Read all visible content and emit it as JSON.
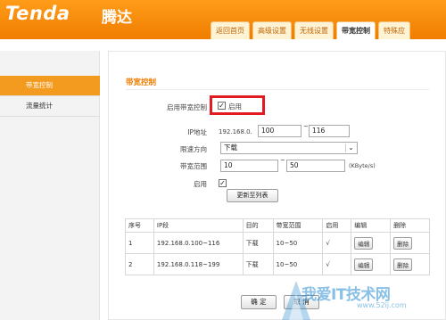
{
  "header": {
    "logo": "Tenda",
    "logo_cn": "腾达",
    "tabs": [
      {
        "label": "返回首页"
      },
      {
        "label": "高级设置"
      },
      {
        "label": "无线设置"
      },
      {
        "label": "带宽控制",
        "active": true
      },
      {
        "label": "特殊应"
      }
    ]
  },
  "sidebar": {
    "items": [
      {
        "label": "带宽控制",
        "active": true
      },
      {
        "label": "流量统计"
      }
    ]
  },
  "form": {
    "title": "带宽控制",
    "enable_label": "启用带宽控制",
    "enable_checkbox_text": "启用",
    "enable_checked": true,
    "ip_label": "IP地址",
    "ip_prefix": "192.168.0.",
    "ip_start": "100",
    "ip_tilde": "~",
    "ip_end": "116",
    "direction_label": "限速方向",
    "direction_value": "下载",
    "range_label": "带宽范围",
    "range_min": "10",
    "range_tilde": "~",
    "range_max": "50",
    "range_unit": "(KByte/s)",
    "enabled_label": "启用",
    "update_button": "更新至列表"
  },
  "table": {
    "headers": [
      "序号",
      "IP段",
      "目的",
      "带宽范围",
      "启用",
      "编辑",
      "删除"
    ],
    "rows": [
      {
        "no": "1",
        "ip": "192.168.0.100~116",
        "dir": "下载",
        "range": "10~50",
        "enabled": "√",
        "edit": "编辑",
        "delete": "删除"
      },
      {
        "no": "2",
        "ip": "192.168.0.118~199",
        "dir": "下载",
        "range": "10~50",
        "enabled": "√",
        "edit": "编辑",
        "delete": "删除"
      }
    ]
  },
  "footer": {
    "ok": "确 定",
    "cancel": "取 消"
  },
  "watermark": {
    "text": "我爱IT技术网",
    "url": "www.52ij.com"
  },
  "colors": {
    "brand_orange": "#f07d00",
    "highlight_red": "#e21b23"
  }
}
